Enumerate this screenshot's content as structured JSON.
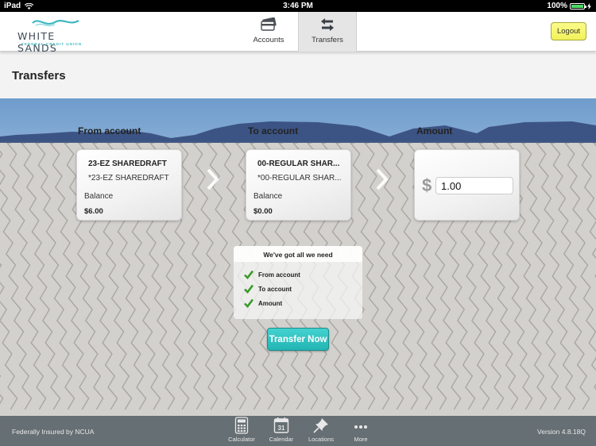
{
  "status_bar": {
    "device": "iPad",
    "time": "3:46 PM",
    "battery": "100%",
    "battery_level_percent": 100
  },
  "header": {
    "logo": {
      "name": "WHITE SANDS",
      "subtitle": "FEDERAL CREDIT UNION"
    },
    "nav": [
      {
        "label": "Accounts",
        "icon": "credit-cards-icon",
        "active": false
      },
      {
        "label": "Transfers",
        "icon": "transfer-arrows-icon",
        "active": true
      }
    ],
    "logout_label": "Logout"
  },
  "page": {
    "title": "Transfers"
  },
  "transfer": {
    "from": {
      "label": "From account",
      "account_name": "23-EZ SHAREDRAFT",
      "account_sub": "*23-EZ SHAREDRAFT",
      "balance_label": "Balance",
      "balance": "$6.00"
    },
    "to": {
      "label": "To account",
      "account_name": "00-REGULAR SHAR...",
      "account_sub": "*00-REGULAR SHAR...",
      "balance_label": "Balance",
      "balance": "$0.00"
    },
    "amount": {
      "label": "Amount",
      "currency_symbol": "$",
      "value": "1.00"
    },
    "checklist": {
      "title": "We've got all we need",
      "items": [
        "From account",
        "To account",
        "Amount"
      ]
    },
    "submit_label": "Transfer Now"
  },
  "footer": {
    "insured_text": "Federally Insured by NCUA",
    "tools": [
      {
        "label": "Calculator",
        "icon": "calculator-icon"
      },
      {
        "label": "Calendar",
        "icon": "calendar-icon",
        "day": "31"
      },
      {
        "label": "Locations",
        "icon": "pushpin-icon"
      },
      {
        "label": "More",
        "icon": "more-dots-icon"
      }
    ],
    "version": "Version 4.8.18Q"
  },
  "colors": {
    "accent_teal": "#2bbdba",
    "logout_yellow": "#f6f66e",
    "check_green": "#3a9a2a",
    "logo_teal": "#3fb8c2",
    "footer_bg": "#5a6468"
  }
}
